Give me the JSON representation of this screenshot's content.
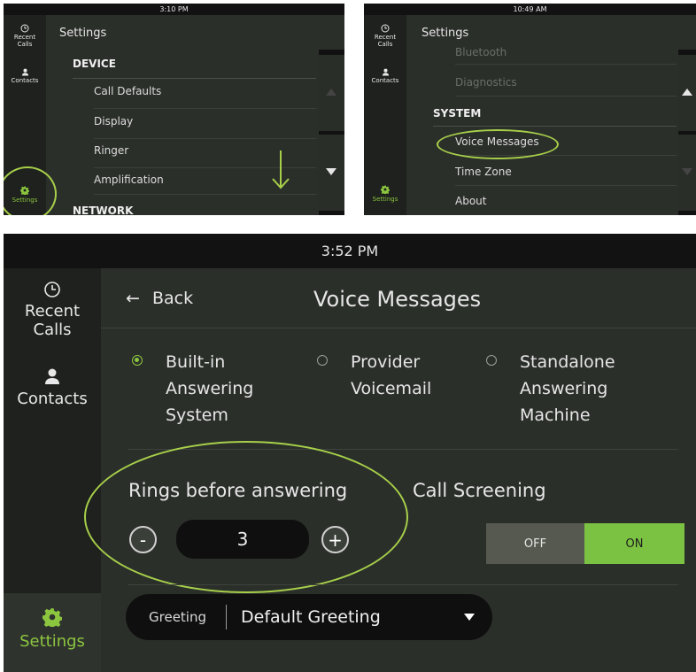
{
  "screen1": {
    "time": "3:10 PM",
    "sidebar": {
      "recent_calls": "Recent Calls",
      "contacts": "Contacts",
      "settings": "Settings"
    },
    "title": "Settings",
    "list": [
      {
        "label": "DEVICE",
        "type": "header"
      },
      {
        "label": "Call Defaults",
        "type": "item"
      },
      {
        "label": "Display",
        "type": "item"
      },
      {
        "label": "Ringer",
        "type": "item"
      },
      {
        "label": "Amplification",
        "type": "item"
      },
      {
        "label": "NETWORK",
        "type": "header"
      }
    ]
  },
  "screen2": {
    "time": "10:49 AM",
    "sidebar": {
      "recent_calls": "Recent Calls",
      "contacts": "Contacts",
      "settings": "Settings"
    },
    "title": "Settings",
    "list": [
      {
        "label": "Bluetooth",
        "type": "dim"
      },
      {
        "label": "Diagnostics",
        "type": "dim"
      },
      {
        "label": "SYSTEM",
        "type": "header"
      },
      {
        "label": "Voice Messages",
        "type": "item"
      },
      {
        "label": "Time Zone",
        "type": "item"
      },
      {
        "label": "About",
        "type": "item"
      }
    ]
  },
  "screen3": {
    "time": "3:52 PM",
    "sidebar": {
      "recent_calls": "Recent Calls",
      "contacts": "Contacts",
      "settings": "Settings"
    },
    "back": "Back",
    "title": "Voice Messages",
    "options": [
      {
        "label": "Built-in Answering System",
        "selected": true
      },
      {
        "label": "Provider Voicemail",
        "selected": false
      },
      {
        "label": "Standalone Answering Machine",
        "selected": false
      }
    ],
    "rings_label": "Rings before answering",
    "rings_value": "3",
    "minus": "-",
    "plus": "+",
    "call_screening_label": "Call Screening",
    "toggle_off": "OFF",
    "toggle_on": "ON",
    "call_screening_state": "ON",
    "greeting_label": "Greeting",
    "greeting_value": "Default Greeting"
  },
  "colors": {
    "accent": "#8cc63f",
    "highlight_ring": "#a7cf4a",
    "background": "#2b2f2a",
    "sidebar": "#1e211d"
  }
}
